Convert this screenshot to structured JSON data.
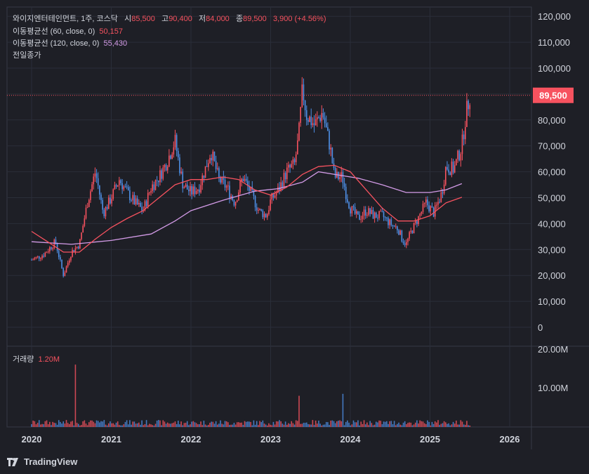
{
  "header": {
    "symbol": "와이지엔터테인먼트, 1주, 코스닥",
    "open_label": "시",
    "open": "85,500",
    "high_label": "고",
    "high": "90,400",
    "low_label": "저",
    "low": "84,000",
    "close_label": "종",
    "close": "89,500",
    "change": "3,900 (+4.56%)"
  },
  "indicators": [
    {
      "label": "이동평균선 (60, close, 0)",
      "value": "50,157",
      "color": "#f7525f"
    },
    {
      "label": "이동평균선 (120, close, 0)",
      "value": "55,430",
      "color": "#d39be7"
    },
    {
      "label": "전일종가",
      "value": ""
    }
  ],
  "volume_pane": {
    "label": "거래량",
    "value": "1.20M"
  },
  "price_tag": "89,500",
  "brand": "TradingView",
  "colors": {
    "bg": "#1e1f26",
    "up": "#f7525f",
    "down": "#4e8fe6",
    "ma60": "#f7525f",
    "ma120": "#d39be7",
    "grid": "#2a2e39",
    "text": "#d1d4dc"
  },
  "chart_data": {
    "type": "candlestick",
    "y_axis": {
      "min": 0,
      "max": 120000,
      "ticks": [
        "120,000",
        "110,000",
        "100,000",
        "90,000",
        "80,000",
        "70,000",
        "60,000",
        "50,000",
        "40,000",
        "30,000",
        "20,000",
        "10,000",
        "0"
      ]
    },
    "volume_axis": {
      "ticks": [
        "20.00M",
        "10.00M"
      ]
    },
    "x_axis": {
      "ticks": [
        "2020",
        "2021",
        "2022",
        "2023",
        "2024",
        "2025",
        "2026"
      ]
    },
    "last_close": 89500,
    "price_path": [
      [
        2020.0,
        26000
      ],
      [
        2020.15,
        28000
      ],
      [
        2020.3,
        33000
      ],
      [
        2020.4,
        20000
      ],
      [
        2020.5,
        29000
      ],
      [
        2020.6,
        32000
      ],
      [
        2020.7,
        48000
      ],
      [
        2020.8,
        60000
      ],
      [
        2020.9,
        44000
      ],
      [
        2021.0,
        50000
      ],
      [
        2021.1,
        57000
      ],
      [
        2021.2,
        52000
      ],
      [
        2021.3,
        48000
      ],
      [
        2021.4,
        45000
      ],
      [
        2021.5,
        54000
      ],
      [
        2021.6,
        58000
      ],
      [
        2021.7,
        64000
      ],
      [
        2021.8,
        72000
      ],
      [
        2021.85,
        63000
      ],
      [
        2021.9,
        55000
      ],
      [
        2022.0,
        52000
      ],
      [
        2022.1,
        54000
      ],
      [
        2022.2,
        63000
      ],
      [
        2022.25,
        68000
      ],
      [
        2022.35,
        57000
      ],
      [
        2022.45,
        54000
      ],
      [
        2022.55,
        48000
      ],
      [
        2022.65,
        58000
      ],
      [
        2022.75,
        52000
      ],
      [
        2022.85,
        45000
      ],
      [
        2022.95,
        43000
      ],
      [
        2023.0,
        49000
      ],
      [
        2023.1,
        53000
      ],
      [
        2023.2,
        60000
      ],
      [
        2023.3,
        63000
      ],
      [
        2023.35,
        73000
      ],
      [
        2023.4,
        92000
      ],
      [
        2023.45,
        82000
      ],
      [
        2023.55,
        78000
      ],
      [
        2023.65,
        83000
      ],
      [
        2023.75,
        69000
      ],
      [
        2023.8,
        58000
      ],
      [
        2023.9,
        58000
      ],
      [
        2023.95,
        51000
      ],
      [
        2024.0,
        46000
      ],
      [
        2024.1,
        42000
      ],
      [
        2024.2,
        45000
      ],
      [
        2024.3,
        43000
      ],
      [
        2024.4,
        43000
      ],
      [
        2024.5,
        40000
      ],
      [
        2024.6,
        38000
      ],
      [
        2024.65,
        34000
      ],
      [
        2024.7,
        32000
      ],
      [
        2024.75,
        36000
      ],
      [
        2024.85,
        42000
      ],
      [
        2024.95,
        48000
      ],
      [
        2025.05,
        44000
      ],
      [
        2025.15,
        52000
      ],
      [
        2025.2,
        62000
      ],
      [
        2025.3,
        61000
      ],
      [
        2025.4,
        70000
      ],
      [
        2025.45,
        82000
      ],
      [
        2025.5,
        89500
      ]
    ],
    "ma60_path": [
      [
        2020.0,
        37000
      ],
      [
        2020.2,
        33000
      ],
      [
        2020.4,
        29000
      ],
      [
        2020.6,
        29000
      ],
      [
        2020.8,
        34000
      ],
      [
        2021.0,
        38500
      ],
      [
        2021.2,
        42000
      ],
      [
        2021.4,
        45000
      ],
      [
        2021.6,
        50000
      ],
      [
        2021.8,
        55000
      ],
      [
        2022.0,
        57000
      ],
      [
        2022.2,
        57000
      ],
      [
        2022.4,
        58000
      ],
      [
        2022.6,
        57000
      ],
      [
        2022.8,
        53000
      ],
      [
        2023.0,
        51000
      ],
      [
        2023.2,
        54000
      ],
      [
        2023.4,
        59000
      ],
      [
        2023.6,
        62000
      ],
      [
        2023.8,
        62500
      ],
      [
        2024.0,
        60000
      ],
      [
        2024.2,
        53000
      ],
      [
        2024.4,
        46000
      ],
      [
        2024.6,
        41000
      ],
      [
        2024.8,
        41000
      ],
      [
        2025.0,
        43000
      ],
      [
        2025.2,
        48000
      ],
      [
        2025.4,
        50157
      ]
    ],
    "ma120_path": [
      [
        2020.0,
        33000
      ],
      [
        2020.5,
        32000
      ],
      [
        2021.0,
        33500
      ],
      [
        2021.5,
        36000
      ],
      [
        2021.8,
        41000
      ],
      [
        2022.0,
        45000
      ],
      [
        2022.4,
        49000
      ],
      [
        2022.8,
        52500
      ],
      [
        2023.1,
        53500
      ],
      [
        2023.4,
        56000
      ],
      [
        2023.6,
        60000
      ],
      [
        2023.9,
        58500
      ],
      [
        2024.1,
        57500
      ],
      [
        2024.4,
        55000
      ],
      [
        2024.7,
        52000
      ],
      [
        2025.0,
        52000
      ],
      [
        2025.2,
        53000
      ],
      [
        2025.4,
        55430
      ]
    ],
    "volume_spikes": [
      [
        2020.55,
        16000000
      ],
      [
        2023.35,
        8000000
      ],
      [
        2023.9,
        8500000
      ]
    ]
  }
}
